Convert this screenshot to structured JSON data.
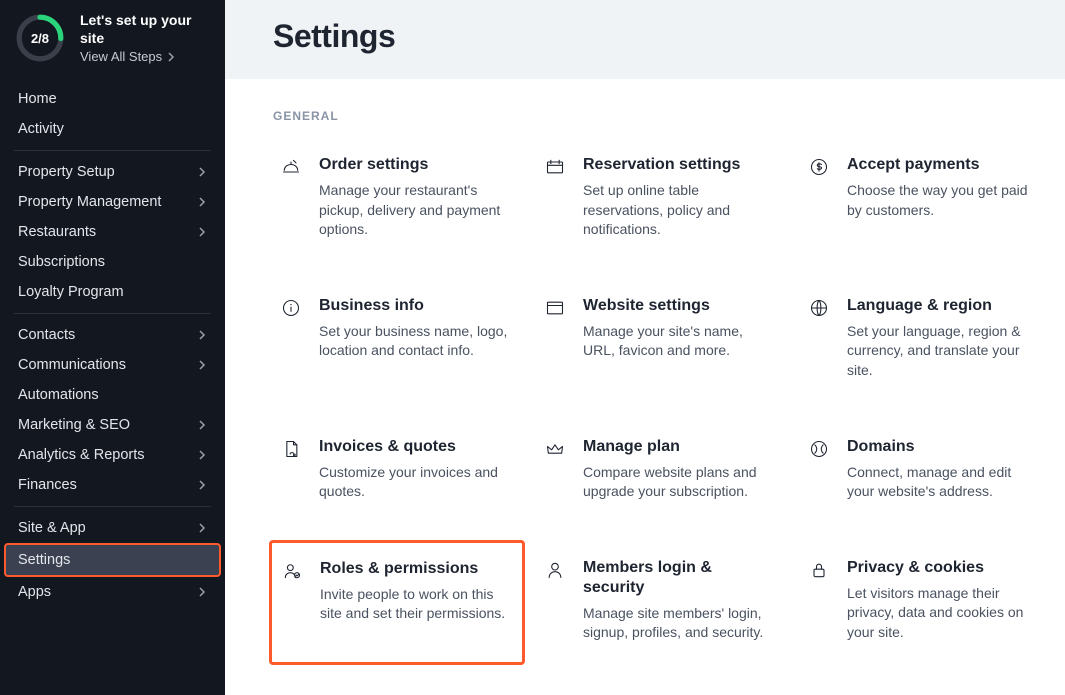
{
  "setup": {
    "progress_label": "2/8",
    "progress_fraction": 0.25,
    "title": "Let's set up your site",
    "link": "View All Steps"
  },
  "nav": {
    "group1": [
      {
        "label": "Home",
        "sub": false
      },
      {
        "label": "Activity",
        "sub": false
      }
    ],
    "group2": [
      {
        "label": "Property Setup",
        "sub": true
      },
      {
        "label": "Property Management",
        "sub": true
      },
      {
        "label": "Restaurants",
        "sub": true
      },
      {
        "label": "Subscriptions",
        "sub": false
      },
      {
        "label": "Loyalty Program",
        "sub": false
      }
    ],
    "group3": [
      {
        "label": "Contacts",
        "sub": true
      },
      {
        "label": "Communications",
        "sub": true
      },
      {
        "label": "Automations",
        "sub": false
      },
      {
        "label": "Marketing & SEO",
        "sub": true
      },
      {
        "label": "Analytics & Reports",
        "sub": true
      },
      {
        "label": "Finances",
        "sub": true
      }
    ],
    "group4": [
      {
        "label": "Site & App",
        "sub": true
      },
      {
        "label": "Settings",
        "sub": false,
        "active": true
      },
      {
        "label": "Apps",
        "sub": true
      }
    ]
  },
  "page": {
    "title": "Settings",
    "section_label": "GENERAL"
  },
  "cards": [
    {
      "icon": "bell-plate-icon",
      "title": "Order settings",
      "desc": "Manage your restaurant's pickup, delivery and payment options."
    },
    {
      "icon": "reservation-icon",
      "title": "Reservation settings",
      "desc": "Set up online table reservations, policy and notifications."
    },
    {
      "icon": "dollar-icon",
      "title": "Accept payments",
      "desc": "Choose the way you get paid by customers."
    },
    {
      "icon": "info-icon",
      "title": "Business info",
      "desc": "Set your business name, logo, location and contact info."
    },
    {
      "icon": "browser-icon",
      "title": "Website settings",
      "desc": "Manage your site's name, URL, favicon and more."
    },
    {
      "icon": "globe-icon",
      "title": "Language & region",
      "desc": "Set your language, region & currency, and translate your site."
    },
    {
      "icon": "invoice-icon",
      "title": "Invoices & quotes",
      "desc": "Customize your invoices and quotes."
    },
    {
      "icon": "crown-icon",
      "title": "Manage plan",
      "desc": "Compare website plans and upgrade your subscription."
    },
    {
      "icon": "domain-icon",
      "title": "Domains",
      "desc": "Connect, manage and edit your website's address."
    },
    {
      "icon": "roles-icon",
      "title": "Roles & permissions",
      "desc": "Invite people to work on this site and set their permissions.",
      "highlight": true
    },
    {
      "icon": "members-icon",
      "title": "Members login & security",
      "desc": "Manage site members' login, signup, profiles, and security."
    },
    {
      "icon": "lock-icon",
      "title": "Privacy & cookies",
      "desc": "Let visitors manage their privacy, data and cookies on your site."
    }
  ]
}
